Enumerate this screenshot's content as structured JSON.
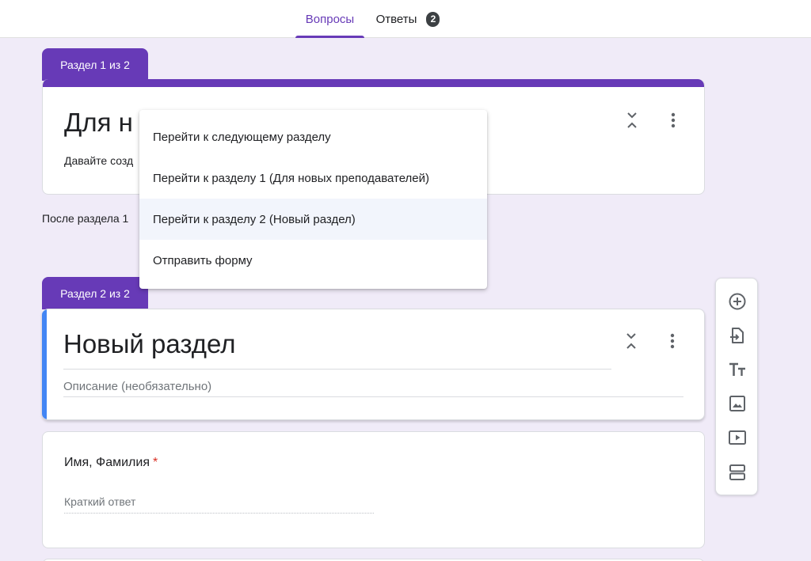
{
  "tabs": {
    "questions_label": "Вопросы",
    "answers_label": "Ответы",
    "answers_count": "2"
  },
  "section1": {
    "label": "Раздел 1 из 2",
    "title": "Для н",
    "description": "Давайте созд"
  },
  "after_section_text": "После раздела 1",
  "section2": {
    "label": "Раздел 2 из 2",
    "title": "Новый раздел",
    "description_placeholder": "Описание (необязательно)"
  },
  "question1": {
    "title": "Имя, Фамилия",
    "required_mark": "*",
    "answer_placeholder": "Краткий ответ"
  },
  "menu": {
    "items": [
      "Перейти к следующему разделу",
      "Перейти к разделу 1 (Для новых преподавателей)",
      "Перейти к разделу 2 (Новый раздел)",
      "Отправить форму"
    ],
    "selected_index": 2
  },
  "toolbar": {
    "icons": [
      "add-question-icon",
      "import-questions-icon",
      "add-title-icon",
      "add-image-icon",
      "add-video-icon",
      "add-section-icon"
    ]
  },
  "colors": {
    "accent": "#673ab7",
    "background": "#f0ebf8",
    "section_focus": "#4285f4",
    "required": "#d93025"
  }
}
